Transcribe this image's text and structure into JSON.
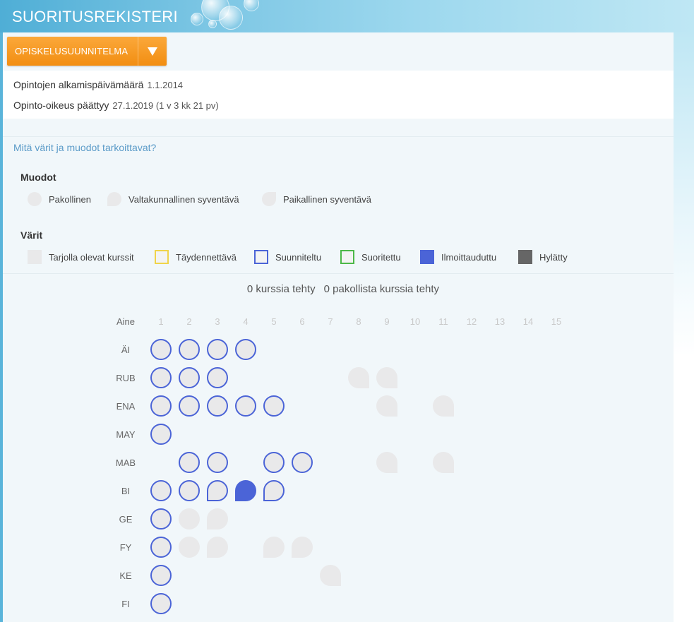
{
  "app": {
    "title": "SUORITUSREKISTERI"
  },
  "plan_button": {
    "label": "OPISKELUSUUNNITELMA",
    "icon": "caret-down-icon"
  },
  "info": {
    "start_label": "Opintojen alkamispäivämäärä",
    "start_value": "1.1.2014",
    "end_label": "Opinto-oikeus päättyy",
    "end_value": "27.1.2019 (1 v 3 kk 21 pv)"
  },
  "help_link": "Mitä värit ja muodot tarkoittavat?",
  "shapes": {
    "title": "Muodot",
    "items": [
      {
        "label": "Pakollinen",
        "shape": "circle"
      },
      {
        "label": "Valtakunnallinen syventävä",
        "shape": "leaf-bottom-left"
      },
      {
        "label": "Paikallinen syventävä",
        "shape": "leaf-top-right"
      }
    ]
  },
  "colors": {
    "title": "Värit",
    "items": [
      {
        "label": "Tarjolla olevat kurssit",
        "fill": "#e9e9ea",
        "border": "#e9e9ea"
      },
      {
        "label": "Täydennettävä",
        "fill": "#f3f3f3",
        "border": "#f0d44a"
      },
      {
        "label": "Suunniteltu",
        "fill": "#f3f3f3",
        "border": "#4b64d7"
      },
      {
        "label": "Suoritettu",
        "fill": "#f3f3f3",
        "border": "#4cb848"
      },
      {
        "label": "Ilmoittauduttu",
        "fill": "#4b64d7",
        "border": "#4b64d7"
      },
      {
        "label": "Hylätty",
        "fill": "#666666",
        "border": "#666666"
      }
    ]
  },
  "summary": {
    "courses_done": "0 kurssia tehty",
    "mandatory_done": "0 pakollista kurssia tehty"
  },
  "grid": {
    "header_label": "Aine",
    "columns": [
      "1",
      "2",
      "3",
      "4",
      "5",
      "6",
      "7",
      "8",
      "9",
      "10",
      "11",
      "12",
      "13",
      "14",
      "15"
    ],
    "rows": [
      {
        "subject": "ÄI",
        "courses": [
          {
            "col": 1,
            "shape": "circle",
            "status": "planned"
          },
          {
            "col": 2,
            "shape": "circle",
            "status": "planned"
          },
          {
            "col": 3,
            "shape": "circle",
            "status": "planned"
          },
          {
            "col": 4,
            "shape": "circle",
            "status": "planned"
          }
        ]
      },
      {
        "subject": "RUB",
        "courses": [
          {
            "col": 1,
            "shape": "circle",
            "status": "planned"
          },
          {
            "col": 2,
            "shape": "circle",
            "status": "planned"
          },
          {
            "col": 3,
            "shape": "circle",
            "status": "planned"
          },
          {
            "col": 8,
            "shape": "leaf-bottom-right",
            "status": "offered"
          },
          {
            "col": 9,
            "shape": "leaf-bottom-right",
            "status": "offered"
          }
        ]
      },
      {
        "subject": "ENA",
        "courses": [
          {
            "col": 1,
            "shape": "circle",
            "status": "planned"
          },
          {
            "col": 2,
            "shape": "circle",
            "status": "planned"
          },
          {
            "col": 3,
            "shape": "circle",
            "status": "planned"
          },
          {
            "col": 4,
            "shape": "circle",
            "status": "planned"
          },
          {
            "col": 5,
            "shape": "circle",
            "status": "planned"
          },
          {
            "col": 9,
            "shape": "leaf-bottom-right",
            "status": "offered"
          },
          {
            "col": 11,
            "shape": "leaf-bottom-right",
            "status": "offered"
          }
        ]
      },
      {
        "subject": "MAY",
        "courses": [
          {
            "col": 1,
            "shape": "circle",
            "status": "planned"
          }
        ]
      },
      {
        "subject": "MAB",
        "courses": [
          {
            "col": 2,
            "shape": "circle",
            "status": "planned"
          },
          {
            "col": 3,
            "shape": "circle",
            "status": "planned"
          },
          {
            "col": 5,
            "shape": "circle",
            "status": "planned"
          },
          {
            "col": 6,
            "shape": "circle",
            "status": "planned"
          },
          {
            "col": 9,
            "shape": "leaf-bottom-right",
            "status": "offered"
          },
          {
            "col": 11,
            "shape": "leaf-bottom-right",
            "status": "offered"
          }
        ]
      },
      {
        "subject": "BI",
        "courses": [
          {
            "col": 1,
            "shape": "circle",
            "status": "planned"
          },
          {
            "col": 2,
            "shape": "circle",
            "status": "planned"
          },
          {
            "col": 3,
            "shape": "leaf-bottom-left",
            "status": "planned"
          },
          {
            "col": 4,
            "shape": "leaf-bottom-left",
            "status": "enrolled"
          },
          {
            "col": 5,
            "shape": "leaf-bottom-left",
            "status": "planned"
          }
        ]
      },
      {
        "subject": "GE",
        "courses": [
          {
            "col": 1,
            "shape": "circle",
            "status": "planned"
          },
          {
            "col": 2,
            "shape": "circle",
            "status": "offered"
          },
          {
            "col": 3,
            "shape": "leaf-bottom-left",
            "status": "offered"
          }
        ]
      },
      {
        "subject": "FY",
        "courses": [
          {
            "col": 1,
            "shape": "circle",
            "status": "planned"
          },
          {
            "col": 2,
            "shape": "circle",
            "status": "offered"
          },
          {
            "col": 3,
            "shape": "leaf-bottom-left",
            "status": "offered"
          },
          {
            "col": 5,
            "shape": "leaf-bottom-left",
            "status": "offered"
          },
          {
            "col": 6,
            "shape": "leaf-bottom-left",
            "status": "offered"
          }
        ]
      },
      {
        "subject": "KE",
        "courses": [
          {
            "col": 1,
            "shape": "circle",
            "status": "planned"
          },
          {
            "col": 7,
            "shape": "leaf-bottom-right",
            "status": "offered"
          }
        ]
      },
      {
        "subject": "FI",
        "courses": [
          {
            "col": 1,
            "shape": "circle",
            "status": "planned"
          }
        ]
      }
    ]
  }
}
